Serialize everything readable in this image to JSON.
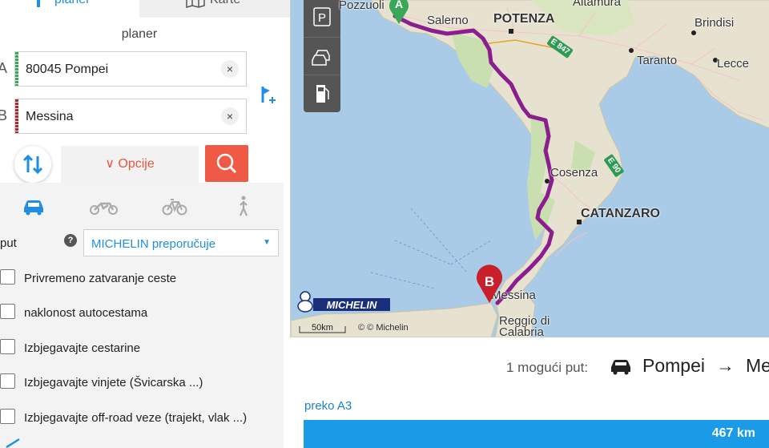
{
  "nav": {
    "tab_planer": "planer",
    "tab_karte": "Karte"
  },
  "planner": {
    "title": "planer",
    "waypoint_a": {
      "letter": "A",
      "value": "80045 Pompei",
      "color": "#3aa657"
    },
    "waypoint_b": {
      "letter": "B",
      "value": "Messina",
      "color": "#b9242b"
    },
    "clear_symbol": "×",
    "options_label": "Opcije",
    "options_chevron": "∨"
  },
  "options": {
    "route_type_label": "put",
    "help_symbol": "?",
    "route_type_value": "MICHELIN preporučuje",
    "select_arrow": "▼",
    "checkboxes": [
      "Privremeno zatvaranje ceste",
      "naklonost autocestama",
      "Izbjegavajte cestarine",
      "Izbjegavajte vinjete (Švicarska ...)",
      "Izbjegavajte off-road veze (trajekt, vlak ...)"
    ],
    "modes": [
      "car-icon",
      "motorbike-icon",
      "bicycle-icon",
      "pedestrian-icon"
    ]
  },
  "map": {
    "labels": {
      "pozzuoli": "Pozzuoli",
      "salerno": "Salerno",
      "potenza": "POTENZA",
      "altamura": "Altamura",
      "brindisi": "Brindisi",
      "taranto": "Taranto",
      "lecce": "Lecce",
      "cosenza": "Cosenza",
      "catanzaro": "CATANZARO",
      "messina": "Messina",
      "reggio": "Reggio di Calabria"
    },
    "highways": [
      "E 847",
      "E 90"
    ],
    "marker_a": "A",
    "marker_b": "B",
    "logo_text": "MICHELIN",
    "scale_label": "50km",
    "copyright": "© © Michelin",
    "route_color": "#8b1e8f"
  },
  "results": {
    "count_text": "1 mogući put:",
    "from": "Pompei",
    "arrow": "→",
    "to": "Messina",
    "via": "preko A3",
    "distance": "467 km",
    "bar_color": "#1a9be7"
  }
}
